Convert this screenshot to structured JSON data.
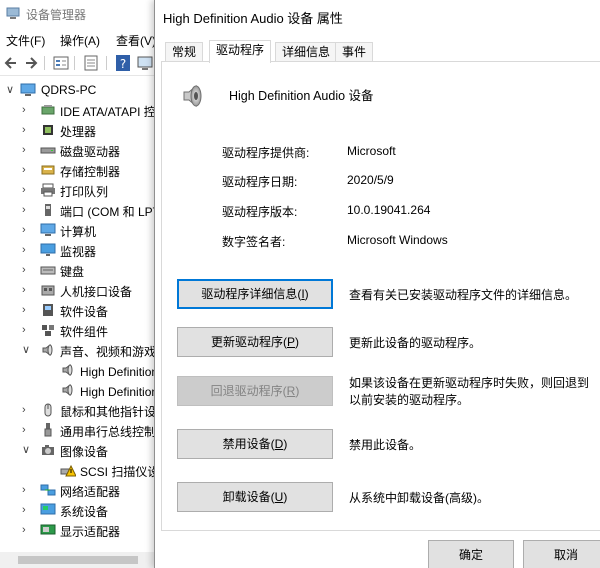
{
  "device_manager": {
    "title": "设备管理器",
    "menu": [
      "文件(F)",
      "操作(A)",
      "查看(V)"
    ],
    "tree": {
      "root": "QDRS-PC",
      "items": [
        {
          "label": "IDE ATA/ATAPI 控制器",
          "icon": "ide-icon",
          "expanded": false
        },
        {
          "label": "处理器",
          "icon": "processor-icon",
          "expanded": false
        },
        {
          "label": "磁盘驱动器",
          "icon": "disk-icon",
          "expanded": false
        },
        {
          "label": "存储控制器",
          "icon": "storage-icon",
          "expanded": false
        },
        {
          "label": "打印队列",
          "icon": "printer-icon",
          "expanded": false
        },
        {
          "label": "端口 (COM 和 LPT)",
          "icon": "port-icon",
          "expanded": false
        },
        {
          "label": "计算机",
          "icon": "computer-icon",
          "expanded": false
        },
        {
          "label": "监视器",
          "icon": "monitor-icon",
          "expanded": false
        },
        {
          "label": "键盘",
          "icon": "keyboard-icon",
          "expanded": false
        },
        {
          "label": "人机接口设备",
          "icon": "hid-icon",
          "expanded": false
        },
        {
          "label": "软件设备",
          "icon": "software-device-icon",
          "expanded": false
        },
        {
          "label": "软件组件",
          "icon": "software-component-icon",
          "expanded": false
        },
        {
          "label": "声音、视频和游戏控制器",
          "icon": "speaker-icon",
          "expanded": true
        },
        {
          "label": "High Definition Audio 设备",
          "icon": "speaker-icon",
          "child": true
        },
        {
          "label": "High Definition Audio 设备",
          "icon": "speaker-icon",
          "child": true
        },
        {
          "label": "鼠标和其他指针设备",
          "icon": "mouse-icon",
          "expanded": false
        },
        {
          "label": "通用串行总线控制器",
          "icon": "usb-icon",
          "expanded": false
        },
        {
          "label": "图像设备",
          "icon": "camera-icon",
          "expanded": true
        },
        {
          "label": "SCSI 扫描仪设备",
          "icon": "scanner-warning-icon",
          "child": true
        },
        {
          "label": "网络适配器",
          "icon": "network-icon",
          "expanded": false
        },
        {
          "label": "系统设备",
          "icon": "system-icon",
          "expanded": false
        },
        {
          "label": "显示适配器",
          "icon": "display-adapter-icon",
          "expanded": false
        }
      ]
    }
  },
  "dialog": {
    "title": "High Definition Audio 设备 属性",
    "tabs": [
      "常规",
      "驱动程序",
      "详细信息",
      "事件"
    ],
    "active_tab": 1,
    "device_name": "High Definition Audio 设备",
    "info": [
      {
        "label": "驱动程序提供商:",
        "value": "Microsoft"
      },
      {
        "label": "驱动程序日期:",
        "value": "2020/5/9"
      },
      {
        "label": "驱动程序版本:",
        "value": "10.0.19041.264"
      },
      {
        "label": "数字签名者:",
        "value": "Microsoft Windows"
      }
    ],
    "buttons": [
      {
        "label": "驱动程序详细信息(",
        "key": "I",
        "suffix": ")",
        "desc": "查看有关已安装驱动程序文件的详细信息。"
      },
      {
        "label": "更新驱动程序(",
        "key": "P",
        "suffix": ")",
        "desc": "更新此设备的驱动程序。"
      },
      {
        "label": "回退驱动程序(",
        "key": "R",
        "suffix": ")",
        "desc": "如果该设备在更新驱动程序时失败，则回退到以前安装的驱动程序。"
      },
      {
        "label": "禁用设备(",
        "key": "D",
        "suffix": ")",
        "desc": "禁用此设备。"
      },
      {
        "label": "卸载设备(",
        "key": "U",
        "suffix": ")",
        "desc": "从系统中卸载设备(高级)。"
      }
    ],
    "ok_label": "确定",
    "cancel_label": "取消"
  },
  "colors": {
    "focus_blue": "#0078d7",
    "button_face": "#e1e1e1",
    "disabled_text": "#838383"
  }
}
